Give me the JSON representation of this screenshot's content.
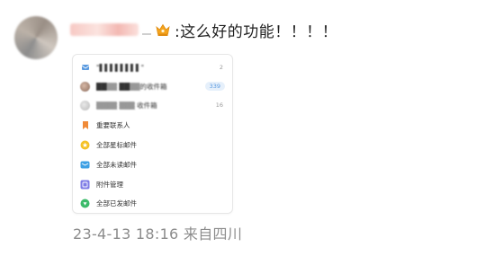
{
  "comment": {
    "text": ":这么好的功能！！！！",
    "meta": "23-4-13 18:16 来自四川"
  },
  "mailbox_card": {
    "rows": [
      {
        "icon": "account-icon",
        "label": "\"▌▌▌▌▌▌▌▌\"",
        "count": "2"
      },
      {
        "icon": "contact-avatar-icon",
        "label": "██▒▒ ██▒▒的收件箱",
        "count": "339"
      },
      {
        "icon": "contact-avatar-icon",
        "label": "▒▒▒▒ ▒▒▒ 收件箱",
        "count": "16"
      },
      {
        "icon": "bookmark-icon",
        "label": "重要联系人",
        "count": ""
      },
      {
        "icon": "star-icon",
        "label": "全部星标邮件",
        "count": ""
      },
      {
        "icon": "mail-icon",
        "label": "全部未读邮件",
        "count": ""
      },
      {
        "icon": "attachment-icon",
        "label": "附件管理",
        "count": ""
      },
      {
        "icon": "sent-icon",
        "label": "全部已发邮件",
        "count": ""
      }
    ]
  },
  "colors": {
    "row_bookmark": "#f08a38",
    "row_star": "#f5c228",
    "row_mail": "#3ea0e4",
    "row_attachment": "#7f7ce6",
    "row_sent": "#3dbb6b",
    "badge_crown": "#f4a41d",
    "meta_text": "#8c8c8c"
  }
}
